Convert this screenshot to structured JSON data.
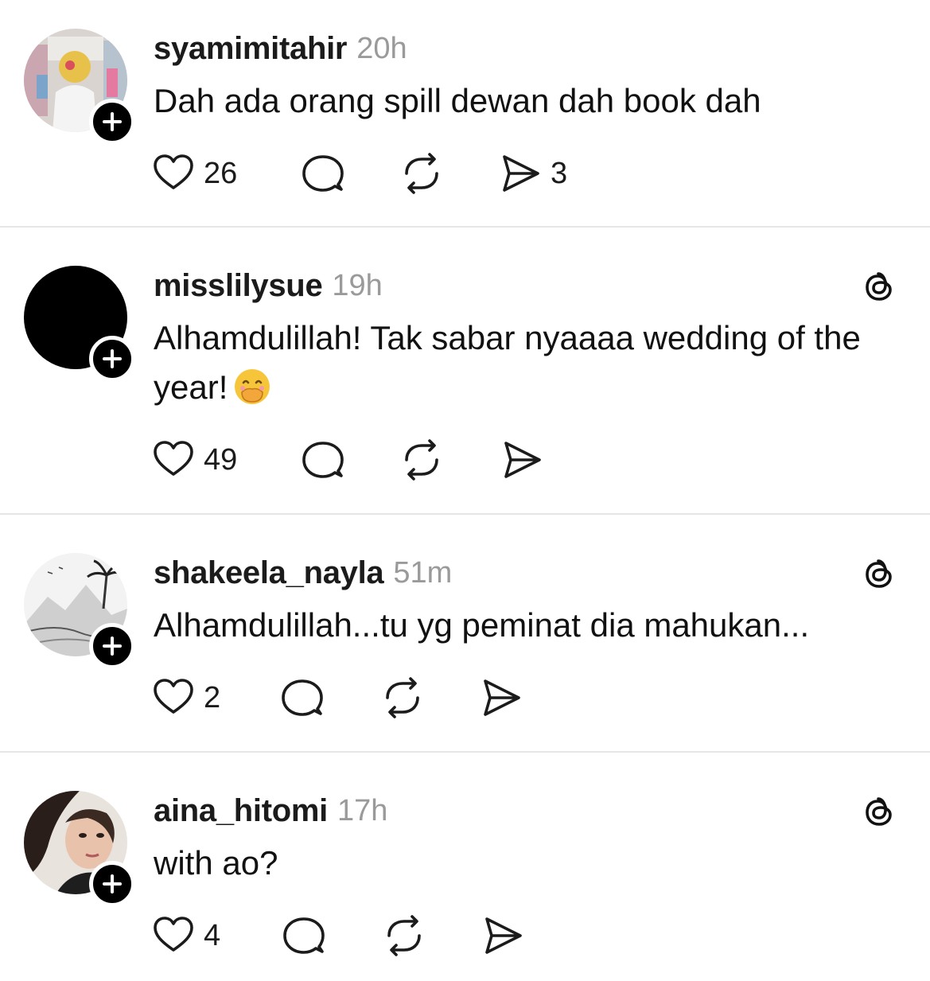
{
  "posts": [
    {
      "username": "syamimitahir",
      "time": "20h",
      "text": "Dah ada orang spill dewan dah book dah",
      "emoji": "",
      "show_threads_logo": false,
      "likes": "26",
      "reposts": "",
      "shares": "3",
      "avatar": "photo-avatar"
    },
    {
      "username": "misslilysue",
      "time": "19h",
      "text": "Alhamdulillah! Tak sabar nyaaaa wedding of the year!",
      "emoji": "face-with-hand-over-mouth",
      "show_threads_logo": true,
      "likes": "49",
      "reposts": "",
      "shares": "",
      "avatar": "black-avatar"
    },
    {
      "username": "shakeela_nayla",
      "time": "51m",
      "text": "Alhamdulillah...tu yg peminat dia mahukan...",
      "emoji": "",
      "show_threads_logo": true,
      "likes": "2",
      "reposts": "",
      "shares": "",
      "avatar": "sketch-avatar"
    },
    {
      "username": "aina_hitomi",
      "time": "17h",
      "text": "with ao?",
      "emoji": "",
      "show_threads_logo": true,
      "likes": "4",
      "reposts": "",
      "shares": "",
      "avatar": "photo-avatar"
    }
  ],
  "icons": {
    "like": "heart-icon",
    "reply": "comment-icon",
    "repost": "repost-icon",
    "share": "send-icon",
    "follow": "plus-icon",
    "app": "threads-logo-icon"
  }
}
